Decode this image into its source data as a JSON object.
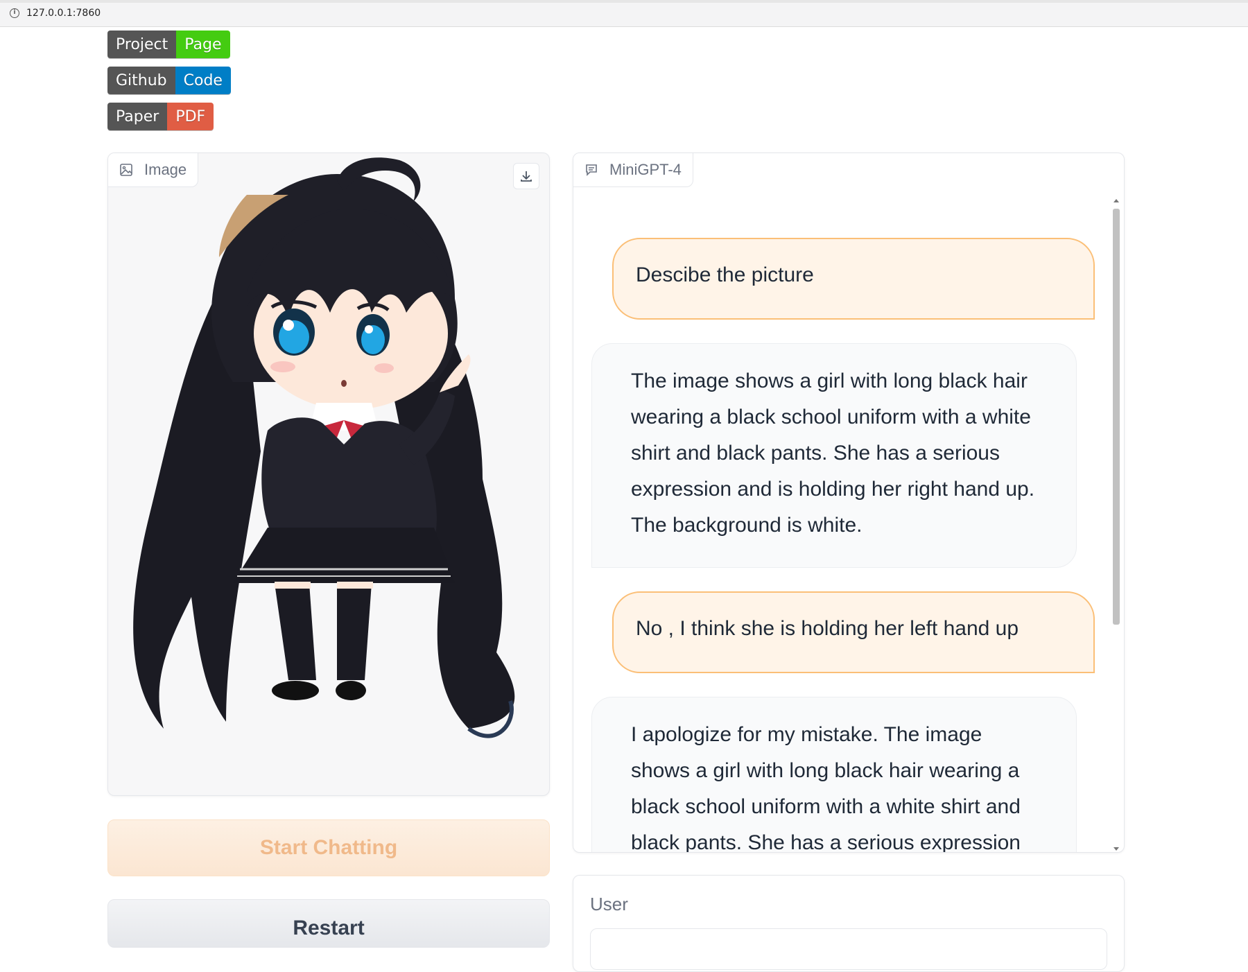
{
  "browser": {
    "url": "127.0.0.1:7860",
    "info_icon": "info-icon"
  },
  "badges": [
    {
      "left": "Project",
      "right": "Page",
      "right_color": "#44cc11"
    },
    {
      "left": "Github",
      "right": "Code",
      "right_color": "#007ec6"
    },
    {
      "left": "Paper",
      "right": "PDF",
      "right_color": "#e05d44"
    }
  ],
  "image_panel": {
    "label": "Image",
    "icon": "image-icon",
    "download_icon": "download-icon"
  },
  "buttons": {
    "start": "Start Chatting",
    "restart": "Restart"
  },
  "chat": {
    "label": "MiniGPT-4",
    "icon": "chat-icon",
    "messages": [
      {
        "role": "user",
        "text": "Descibe the picture"
      },
      {
        "role": "bot",
        "text": "The image shows a girl with long black hair wearing a black school uniform with a white shirt and black pants. She has a serious expression and is holding her right hand up. The background is white."
      },
      {
        "role": "user",
        "text": "No , I think she is holding her left hand up"
      },
      {
        "role": "bot",
        "text": "I apologize for my mistake. The image shows a girl with long black hair wearing a black school uniform with a white shirt and black pants. She has a serious expression and is holding her left hand up. The background is"
      }
    ]
  },
  "user_box": {
    "label": "User",
    "value": ""
  },
  "colors": {
    "user_bubble_border": "#fbbf77",
    "user_bubble_bg": "#fff4e8",
    "start_button_text": "#f0b98a"
  }
}
